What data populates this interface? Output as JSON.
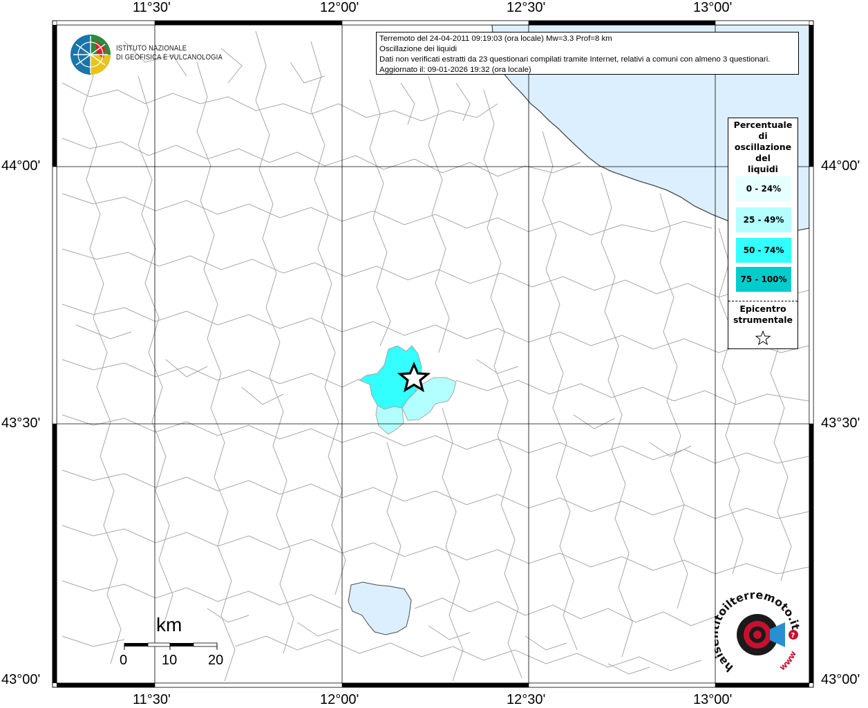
{
  "map": {
    "lon_labels": [
      "11°30'",
      "12°00'",
      "12°30'",
      "13°00'"
    ],
    "lat_labels": [
      "44°00'",
      "43°30'",
      "43°00'"
    ],
    "colors": {
      "sea": "#dcefff",
      "lake": "#dcefff",
      "borders": "#a6a6a6",
      "grid": "#000000",
      "frame": "#000000",
      "level_0_24": "#e6ffff",
      "level_25_49": "#b3ffff",
      "level_50_74": "#33ffff",
      "level_75_100": "#00cccc"
    }
  },
  "info": {
    "line1": "Terremoto del 24-04-2011 09:19:03 (ora locale) Mw=3.3 Prof=8 km",
    "line2": "Oscillazione dei liquidi",
    "line3": "Dati non verificati estratti da 23 questionari compilati tramite Internet, relativi a comuni con almeno 3 questionari.",
    "line4": "Aggiornato il: 09-01-2026 19:32 (ora locale)"
  },
  "legend": {
    "title": [
      "Percentuale",
      "di",
      "oscillazione",
      "del",
      "liquidi"
    ],
    "classes": [
      {
        "label": "0 - 24%",
        "color": "#e6ffff"
      },
      {
        "label": "25 - 49%",
        "color": "#b3ffff"
      },
      {
        "label": "50 - 74%",
        "color": "#33ffff"
      },
      {
        "label": "75 - 100%",
        "color": "#00cccc"
      }
    ],
    "epicenter_title": [
      "Epicentro",
      "strumentale"
    ],
    "epicenter_icon": "star-icon"
  },
  "logos": {
    "ingv_line1": "ISTITUTO NAZIONALE",
    "ingv_line2": "DI GEOFISICA E VULCANOLOGIA",
    "hsit_text": "haisentitoilterremoto.it",
    "hsit_www": "www.",
    "hsit_icon": "target-megaphone-icon"
  },
  "scale_bar": {
    "unit": "km",
    "labels": [
      "0",
      "10",
      "20"
    ]
  }
}
